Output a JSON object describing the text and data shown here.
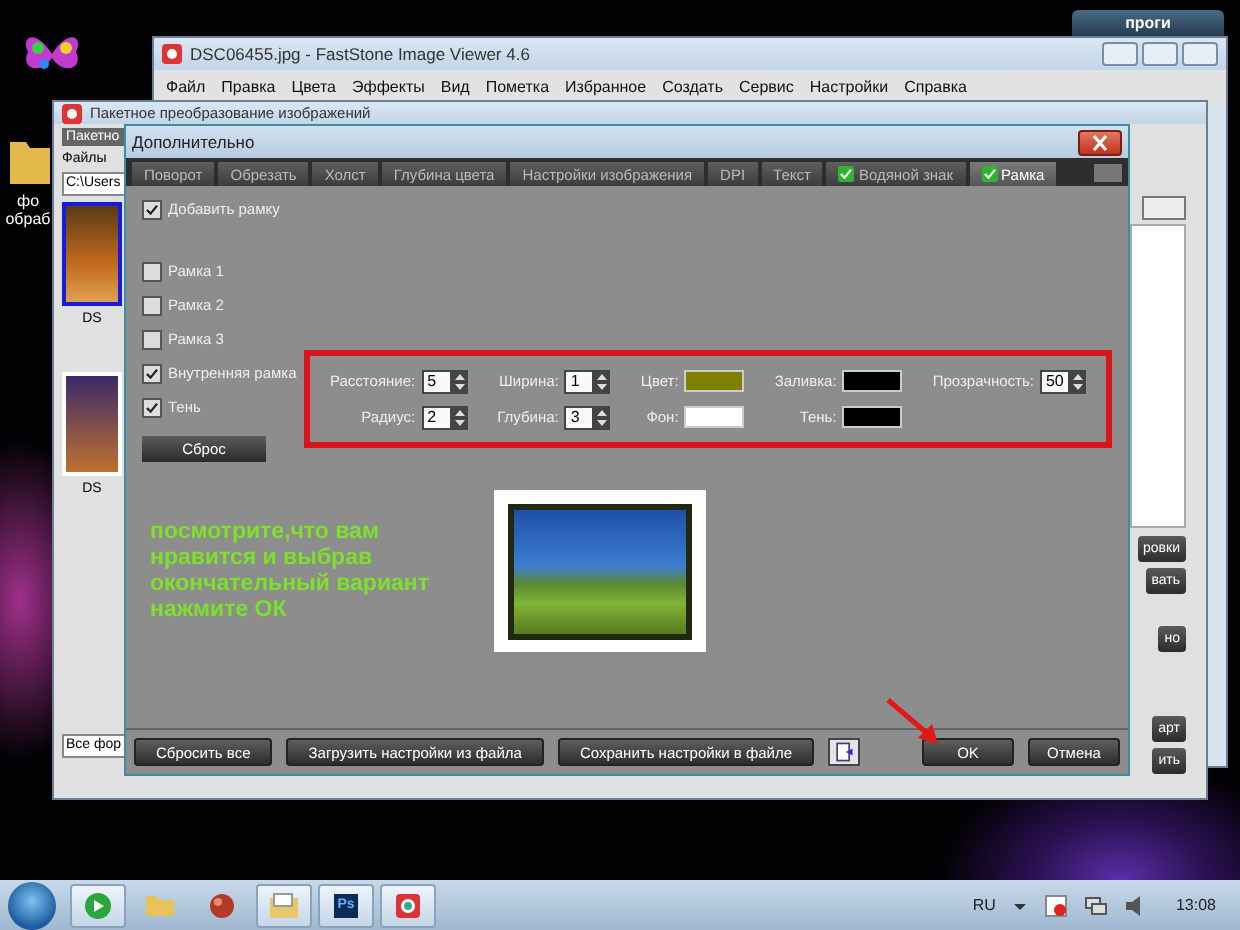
{
  "desktop": {
    "icon_label": "фо обраб",
    "shortcut_tab": "проги"
  },
  "viewer_window": {
    "title": "DSC06455.jpg - FastStone Image Viewer 4.6",
    "menu": [
      "Файл",
      "Правка",
      "Цвета",
      "Эффекты",
      "Вид",
      "Пометка",
      "Избранное",
      "Создать",
      "Сервис",
      "Настройки",
      "Справка"
    ]
  },
  "batch_window": {
    "title": "Пакетное преобразование изображений",
    "tab": "Пакетно",
    "files_label": "Файлы",
    "path": "C:\\Users",
    "thumbnails": [
      {
        "caption": "DS",
        "selected": true
      },
      {
        "caption": "DS",
        "selected": false
      }
    ],
    "format_field": "Все фор",
    "side_buttons": [
      "ровки",
      "вать",
      "но",
      "арт",
      "ить"
    ]
  },
  "dialog": {
    "title": "Дополнительно",
    "tabs": [
      {
        "label": "Поворот",
        "checked": false,
        "selected": false
      },
      {
        "label": "Обрезать",
        "checked": false,
        "selected": false
      },
      {
        "label": "Холст",
        "checked": false,
        "selected": false
      },
      {
        "label": "Глубина цвета",
        "checked": false,
        "selected": false
      },
      {
        "label": "Настройки изображения",
        "checked": false,
        "selected": false
      },
      {
        "label": "DPI",
        "checked": false,
        "selected": false
      },
      {
        "label": "Текст",
        "checked": false,
        "selected": false
      },
      {
        "label": "Водяной знак",
        "checked": true,
        "selected": false
      },
      {
        "label": "Рамка",
        "checked": true,
        "selected": true
      }
    ],
    "add_frame": {
      "label": "Добавить  рамку",
      "checked": true
    },
    "frame_options": [
      {
        "label": "Рамка 1",
        "checked": false
      },
      {
        "label": "Рамка 2",
        "checked": false
      },
      {
        "label": "Рамка 3",
        "checked": false
      },
      {
        "label": "Внутренняя рамка",
        "checked": true
      },
      {
        "label": "Тень",
        "checked": true
      }
    ],
    "reset_button": "Сброс",
    "fields": [
      {
        "kind": "number",
        "label": "Расстояние:",
        "value": "5"
      },
      {
        "kind": "number",
        "label": "Ширина:",
        "value": "1"
      },
      {
        "kind": "color",
        "label": "Цвет:",
        "color": "#808000"
      },
      {
        "kind": "color",
        "label": "Заливка:",
        "color": "#000000"
      },
      {
        "kind": "number",
        "label": "Прозрачность:",
        "value": "50"
      },
      {
        "kind": "number",
        "label": "Радиус:",
        "value": "2"
      },
      {
        "kind": "number",
        "label": "Глубина:",
        "value": "3"
      },
      {
        "kind": "color",
        "label": "Фон:",
        "color": "#ffffff"
      },
      {
        "kind": "color",
        "label": "Тень:",
        "color": "#000000"
      }
    ],
    "left_buttons": [
      "Сбросить все",
      "Загрузить настройки из файла",
      "Сохранить настройки в файле"
    ],
    "right_buttons": [
      "OK",
      "Отмена"
    ]
  },
  "annotation": "посмотрите,что вам нравится и выбрав окончательный вариант нажмите ОК",
  "taskbar": {
    "apps": [
      {
        "kind": "media",
        "running": true
      },
      {
        "kind": "folder",
        "running": false
      },
      {
        "kind": "red-ball",
        "running": false
      },
      {
        "kind": "files",
        "running": true
      },
      {
        "kind": "letters",
        "running": true,
        "label": "Ps"
      },
      {
        "kind": "viewer",
        "running": true
      }
    ],
    "language": "RU",
    "clock": "13:08"
  }
}
